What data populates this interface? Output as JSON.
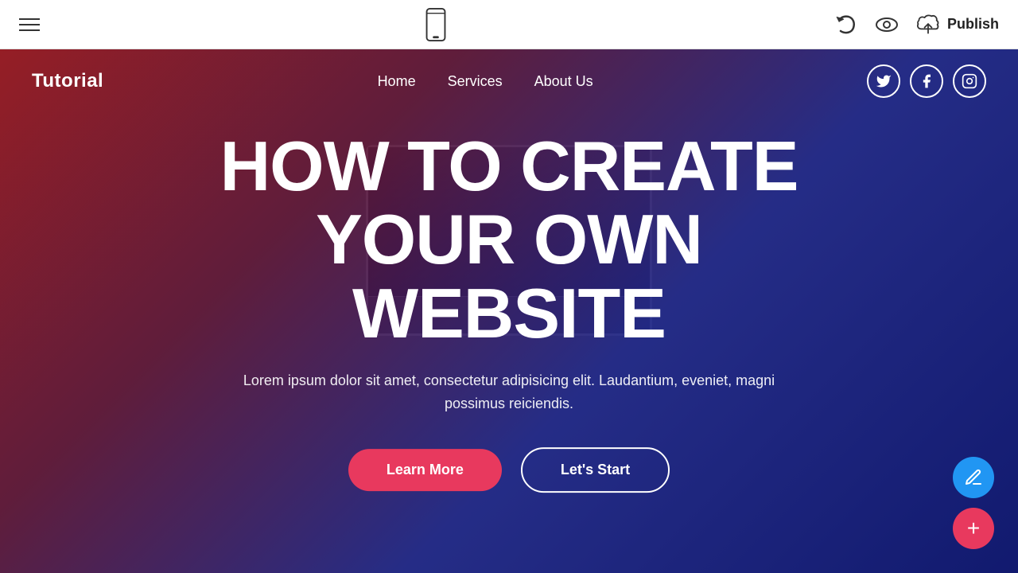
{
  "toolbar": {
    "publish_label": "Publish",
    "undo_title": "Undo",
    "preview_title": "Preview",
    "publish_title": "Publish site",
    "mobile_preview_title": "Mobile preview"
  },
  "site": {
    "logo": "Tutorial",
    "nav": {
      "links": [
        {
          "label": "Home",
          "id": "nav-home"
        },
        {
          "label": "Services",
          "id": "nav-services"
        },
        {
          "label": "About Us",
          "id": "nav-about"
        }
      ]
    },
    "social": [
      {
        "label": "Twitter",
        "icon": "𝕋",
        "id": "twitter"
      },
      {
        "label": "Facebook",
        "icon": "f",
        "id": "facebook"
      },
      {
        "label": "Instagram",
        "icon": "🅘",
        "id": "instagram"
      }
    ]
  },
  "hero": {
    "title_line1": "HOW TO CREATE",
    "title_line2": "YOUR OWN WEBSITE",
    "subtitle": "Lorem ipsum dolor sit amet, consectetur adipisicing elit. Laudantium, eveniet, magni possimus reiciendis.",
    "btn_learn_more": "Learn More",
    "btn_lets_start": "Let's Start"
  },
  "fab": {
    "edit_icon": "✏",
    "add_icon": "+"
  }
}
